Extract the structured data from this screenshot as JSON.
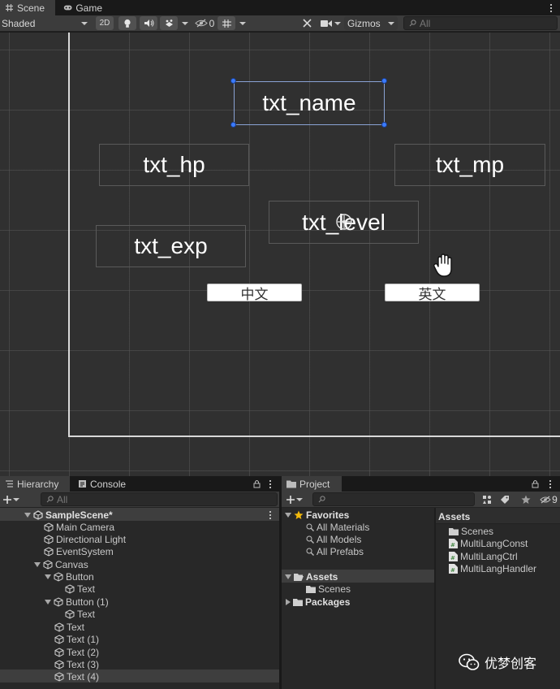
{
  "scene_tabs": {
    "scene": "Scene",
    "game": "Game"
  },
  "scene_toolbar": {
    "shading_mode": "Shaded",
    "mode_2d": "2D",
    "hidden_count": "0",
    "gizmos": "Gizmos",
    "search_placeholder": "All"
  },
  "scene": {
    "elements": {
      "txt_name": "txt_name",
      "txt_hp": "txt_hp",
      "txt_mp": "txt_mp",
      "txt_level": "txt_level",
      "txt_exp": "txt_exp"
    },
    "buttons": {
      "chinese": "中文",
      "english": "英文"
    }
  },
  "hierarchy": {
    "tab": "Hierarchy",
    "console_tab": "Console",
    "search_placeholder": "All",
    "scene_name": "SampleScene*",
    "items": [
      {
        "label": "Main Camera"
      },
      {
        "label": "Directional Light"
      },
      {
        "label": "EventSystem"
      },
      {
        "label": "Canvas"
      },
      {
        "label": "Button"
      },
      {
        "label": "Text"
      },
      {
        "label": "Button (1)"
      },
      {
        "label": "Text"
      },
      {
        "label": "Text"
      },
      {
        "label": "Text (1)"
      },
      {
        "label": "Text (2)"
      },
      {
        "label": "Text (3)"
      },
      {
        "label": "Text (4)"
      }
    ]
  },
  "project": {
    "tab": "Project",
    "hidden_count": "9",
    "favorites": {
      "label": "Favorites",
      "items": [
        "All Materials",
        "All Models",
        "All Prefabs"
      ]
    },
    "tree": {
      "assets": "Assets",
      "scenes": "Scenes",
      "packages": "Packages"
    },
    "assets_header": "Assets",
    "assets_items": [
      "Scenes",
      "MultiLangConst",
      "MultiLangCtrl",
      "MultiLangHandler"
    ]
  },
  "watermark": "优梦创客",
  "colors": {
    "panel_bg": "#282828",
    "toolbar_bg": "#3c3c3c",
    "scene_bg": "#303030",
    "selection_handle": "#3a7bff",
    "selected_row": "#3e3e3e",
    "favorites_star": "#f2b90c"
  }
}
